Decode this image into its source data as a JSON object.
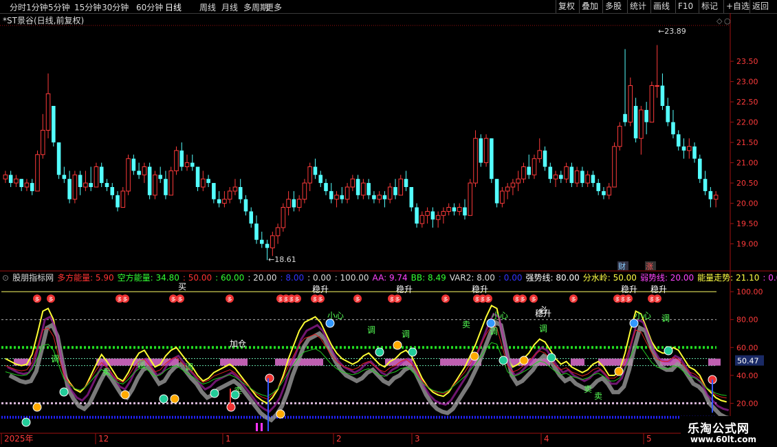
{
  "toolbar": {
    "periods": [
      "分时",
      "1分钟",
      "5分钟",
      "15分钟",
      "30分钟",
      "60分钟",
      "日线",
      "周线",
      "月线",
      "多周期",
      "更多"
    ],
    "active": "日线",
    "right_items": [
      "复权",
      "叠加",
      "多股",
      "统计",
      "画线",
      "F10",
      "标记",
      "+自选",
      "返回"
    ]
  },
  "main_chart": {
    "title": "*ST景谷(日线,前复权)",
    "high_marker": "23.89",
    "low_marker": "18.61",
    "markers": {
      "cai": "财",
      "zhang": "涨"
    },
    "colors": {
      "up": "#ff3b3b",
      "down": "#54ffff"
    }
  },
  "indicator": {
    "name": "股朋指标网",
    "fields": [
      {
        "label": "多方能量:",
        "value": "5.90",
        "color": "#ff3333"
      },
      {
        "label": "空方能量:",
        "value": "34.80",
        "color": "#33ff33"
      },
      {
        "label": ":",
        "value": "50.00",
        "color": "#ff3333"
      },
      {
        "label": ":",
        "value": "60.00",
        "color": "#33ff33"
      },
      {
        "label": ":",
        "value": "20.00",
        "color": "#dddddd"
      },
      {
        "label": ":",
        "value": "8.00",
        "color": "#3333ff"
      },
      {
        "label": ":",
        "value": "0.00",
        "color": "#dddddd"
      },
      {
        "label": ":",
        "value": "100.00",
        "color": "#dddddd"
      },
      {
        "label": "AA:",
        "value": "9.74",
        "color": "#ff44ff"
      },
      {
        "label": "BB:",
        "value": "8.49",
        "color": "#33ff33"
      },
      {
        "label": "VAR2:",
        "value": "8.00",
        "color": "#dddddd"
      },
      {
        "label": ":",
        "value": "0.00",
        "color": "#3333ff"
      },
      {
        "label": "强势线:",
        "value": "80.00",
        "color": "#ffffff"
      },
      {
        "label": "分水岭:",
        "value": "50.00",
        "color": "#ffff44"
      },
      {
        "label": "弱势线:",
        "value": "20.00",
        "color": "#ff44ff"
      },
      {
        "label": "能量走势:",
        "value": "21.10",
        "color": "#ffff44"
      },
      {
        "label": ":",
        "value": "0.00",
        "color": "#ff44ff"
      }
    ],
    "current_value": "50.47",
    "labels": {
      "buy": "买",
      "stable": "稳升",
      "careful": "小心",
      "adjust": "调",
      "sell": "卖",
      "add": "加仓",
      "bi": "必"
    }
  },
  "date_axis": [
    "2025年",
    "12",
    "1",
    "2",
    "3",
    "4",
    "5"
  ],
  "watermark": {
    "line1": "乐淘公式网",
    "line2": "www.60lt.com"
  },
  "chart_data": {
    "type": "candlestick",
    "title": "*ST景谷(日线,前复权)",
    "y_ticks": [
      19.0,
      19.5,
      20.0,
      20.5,
      21.0,
      21.5,
      22.0,
      22.5,
      23.0,
      23.5
    ],
    "ylim": [
      18.4,
      24.4
    ],
    "x_labels": [
      "2025年",
      "12",
      "1",
      "2",
      "3",
      "4",
      "5"
    ],
    "candles": [
      [
        20.6,
        20.8,
        20.5,
        20.7
      ],
      [
        20.7,
        20.8,
        20.4,
        20.5
      ],
      [
        20.5,
        20.7,
        20.4,
        20.6
      ],
      [
        20.6,
        20.6,
        20.3,
        20.4
      ],
      [
        20.4,
        20.6,
        20.3,
        20.5
      ],
      [
        20.5,
        20.6,
        20.2,
        20.3
      ],
      [
        20.3,
        21.3,
        20.3,
        21.2
      ],
      [
        21.2,
        22.2,
        21.1,
        21.8
      ],
      [
        21.8,
        23.2,
        21.6,
        22.7
      ],
      [
        22.4,
        22.4,
        21.4,
        21.5
      ],
      [
        21.5,
        21.5,
        20.6,
        20.7
      ],
      [
        20.7,
        20.9,
        20.5,
        20.6
      ],
      [
        20.6,
        20.8,
        20.0,
        20.1
      ],
      [
        20.1,
        20.8,
        20.0,
        20.7
      ],
      [
        20.7,
        20.8,
        20.2,
        20.4
      ],
      [
        20.4,
        20.8,
        20.3,
        20.5
      ],
      [
        20.5,
        20.9,
        20.3,
        20.4
      ],
      [
        20.4,
        21.0,
        20.4,
        20.9
      ],
      [
        20.9,
        21.0,
        20.4,
        20.5
      ],
      [
        20.5,
        20.6,
        20.3,
        20.4
      ],
      [
        20.4,
        20.5,
        20.1,
        20.2
      ],
      [
        20.2,
        20.3,
        19.8,
        19.9
      ],
      [
        19.9,
        20.4,
        19.9,
        20.3
      ],
      [
        20.3,
        21.2,
        20.2,
        21.1
      ],
      [
        21.1,
        21.2,
        20.7,
        20.8
      ],
      [
        20.8,
        21.0,
        20.6,
        20.7
      ],
      [
        20.7,
        21.0,
        20.5,
        20.9
      ],
      [
        20.9,
        21.0,
        20.1,
        20.2
      ],
      [
        20.2,
        20.8,
        20.1,
        20.7
      ],
      [
        20.7,
        20.9,
        20.5,
        20.6
      ],
      [
        20.6,
        20.8,
        20.1,
        20.2
      ],
      [
        20.2,
        20.9,
        20.2,
        20.8
      ],
      [
        20.8,
        21.4,
        20.7,
        21.3
      ],
      [
        21.3,
        21.5,
        20.8,
        20.9
      ],
      [
        20.9,
        21.2,
        20.8,
        21.0
      ],
      [
        21.0,
        21.2,
        20.8,
        20.9
      ],
      [
        20.9,
        20.9,
        20.3,
        20.4
      ],
      [
        20.4,
        20.8,
        20.3,
        20.6
      ],
      [
        20.6,
        20.7,
        20.4,
        20.5
      ],
      [
        20.5,
        20.5,
        20.0,
        20.1
      ],
      [
        20.1,
        20.3,
        19.9,
        20.0
      ],
      [
        20.0,
        20.3,
        19.9,
        20.1
      ],
      [
        20.1,
        20.4,
        20.0,
        20.3
      ],
      [
        20.3,
        20.6,
        20.2,
        20.4
      ],
      [
        20.4,
        20.6,
        20.0,
        20.1
      ],
      [
        20.1,
        20.2,
        19.7,
        19.8
      ],
      [
        19.8,
        19.9,
        19.4,
        19.5
      ],
      [
        19.5,
        19.7,
        19.0,
        19.1
      ],
      [
        19.1,
        19.3,
        18.9,
        19.0
      ],
      [
        19.0,
        19.1,
        18.6,
        18.9
      ],
      [
        18.9,
        19.3,
        18.7,
        19.2
      ],
      [
        19.2,
        19.5,
        19.0,
        19.4
      ],
      [
        19.4,
        20.0,
        19.3,
        19.9
      ],
      [
        19.9,
        20.3,
        19.7,
        20.1
      ],
      [
        20.1,
        20.3,
        19.8,
        19.9
      ],
      [
        19.9,
        20.2,
        19.8,
        20.1
      ],
      [
        20.1,
        20.6,
        20.0,
        20.5
      ],
      [
        20.5,
        21.0,
        20.3,
        20.9
      ],
      [
        20.9,
        21.1,
        20.6,
        20.7
      ],
      [
        20.7,
        20.8,
        20.4,
        20.5
      ],
      [
        20.5,
        20.6,
        20.2,
        20.3
      ],
      [
        20.3,
        20.5,
        20.0,
        20.1
      ],
      [
        20.1,
        20.3,
        19.9,
        20.2
      ],
      [
        20.2,
        20.4,
        20.0,
        20.1
      ],
      [
        20.1,
        20.5,
        20.0,
        20.4
      ],
      [
        20.4,
        20.7,
        20.3,
        20.6
      ],
      [
        20.6,
        20.7,
        20.1,
        20.2
      ],
      [
        20.2,
        20.6,
        20.1,
        20.5
      ],
      [
        20.5,
        20.6,
        20.1,
        20.2
      ],
      [
        20.2,
        20.3,
        20.0,
        20.1
      ],
      [
        20.1,
        20.3,
        20.0,
        20.2
      ],
      [
        20.2,
        20.3,
        19.9,
        20.1
      ],
      [
        20.1,
        20.5,
        20.0,
        20.4
      ],
      [
        20.4,
        20.6,
        20.1,
        20.2
      ],
      [
        20.2,
        20.7,
        20.2,
        20.6
      ],
      [
        20.6,
        20.8,
        20.3,
        20.4
      ],
      [
        20.4,
        20.4,
        19.8,
        19.9
      ],
      [
        19.9,
        20.0,
        19.4,
        19.5
      ],
      [
        19.5,
        19.8,
        19.4,
        19.7
      ],
      [
        19.7,
        19.9,
        19.5,
        19.8
      ],
      [
        19.8,
        19.9,
        19.4,
        19.6
      ],
      [
        19.6,
        19.8,
        19.4,
        19.7
      ],
      [
        19.7,
        19.9,
        19.5,
        19.8
      ],
      [
        19.8,
        20.0,
        19.7,
        19.9
      ],
      [
        19.9,
        20.0,
        19.7,
        19.8
      ],
      [
        19.8,
        20.0,
        19.7,
        19.9
      ],
      [
        19.9,
        20.1,
        19.6,
        19.7
      ],
      [
        19.7,
        20.6,
        19.7,
        20.5
      ],
      [
        20.5,
        21.8,
        20.4,
        21.6
      ],
      [
        21.6,
        21.7,
        20.9,
        21.0
      ],
      [
        21.0,
        21.7,
        20.9,
        21.6
      ],
      [
        21.6,
        21.6,
        20.5,
        20.6
      ],
      [
        20.6,
        20.6,
        19.9,
        20.0
      ],
      [
        20.0,
        20.4,
        19.9,
        20.3
      ],
      [
        20.3,
        20.5,
        20.1,
        20.4
      ],
      [
        20.4,
        20.6,
        20.2,
        20.5
      ],
      [
        20.5,
        20.8,
        20.3,
        20.6
      ],
      [
        20.6,
        21.0,
        20.5,
        20.9
      ],
      [
        20.9,
        21.2,
        20.6,
        20.7
      ],
      [
        20.7,
        21.2,
        20.6,
        21.1
      ],
      [
        21.1,
        21.6,
        21.0,
        21.3
      ],
      [
        21.3,
        21.4,
        20.8,
        20.9
      ],
      [
        20.9,
        21.0,
        20.5,
        20.6
      ],
      [
        20.6,
        20.8,
        20.4,
        20.7
      ],
      [
        20.7,
        20.8,
        20.5,
        20.6
      ],
      [
        20.6,
        21.0,
        20.5,
        20.9
      ],
      [
        20.9,
        21.0,
        20.4,
        20.5
      ],
      [
        20.5,
        20.9,
        20.4,
        20.8
      ],
      [
        20.8,
        20.9,
        20.4,
        20.5
      ],
      [
        20.5,
        20.8,
        20.4,
        20.7
      ],
      [
        20.7,
        20.8,
        20.4,
        20.5
      ],
      [
        20.5,
        20.6,
        20.2,
        20.3
      ],
      [
        20.3,
        20.4,
        20.1,
        20.2
      ],
      [
        20.2,
        20.5,
        20.1,
        20.4
      ],
      [
        20.4,
        21.5,
        20.4,
        21.4
      ],
      [
        21.4,
        22.0,
        21.3,
        21.9
      ],
      [
        22.2,
        23.8,
        21.9,
        22.0
      ],
      [
        22.0,
        23.1,
        21.9,
        22.9
      ],
      [
        22.4,
        22.6,
        21.5,
        21.6
      ],
      [
        21.6,
        22.4,
        21.2,
        22.3
      ],
      [
        22.3,
        22.5,
        21.7,
        22.0
      ],
      [
        22.0,
        23.0,
        22.0,
        22.9
      ],
      [
        22.9,
        23.9,
        22.6,
        22.9
      ],
      [
        22.9,
        23.2,
        22.3,
        22.4
      ],
      [
        22.4,
        22.6,
        21.9,
        22.0
      ],
      [
        22.0,
        22.3,
        21.6,
        21.7
      ],
      [
        21.7,
        21.8,
        21.3,
        21.4
      ],
      [
        21.4,
        21.6,
        21.1,
        21.3
      ],
      [
        21.3,
        21.6,
        21.1,
        21.4
      ],
      [
        21.4,
        21.5,
        21.0,
        21.1
      ],
      [
        21.1,
        21.2,
        20.5,
        20.6
      ],
      [
        20.6,
        20.8,
        20.2,
        20.3
      ],
      [
        20.3,
        20.4,
        19.9,
        20.1
      ],
      [
        20.1,
        20.3,
        19.9,
        20.2
      ]
    ],
    "indicator_yticks": [
      20.0,
      40.0,
      60.0,
      80.0,
      100.0
    ],
    "indicator_ylim": [
      0,
      105
    ],
    "indicator_series": {
      "yellow_energy": [
        52,
        50,
        48,
        47,
        48,
        55,
        70,
        86,
        88,
        80,
        60,
        42,
        35,
        30,
        28,
        32,
        40,
        48,
        55,
        50,
        44,
        38,
        36,
        42,
        50,
        56,
        58,
        52,
        46,
        48,
        54,
        58,
        60,
        55,
        50,
        46,
        40,
        36,
        38,
        42,
        44,
        46,
        48,
        45,
        40,
        35,
        30,
        25,
        22,
        20,
        24,
        30,
        40,
        52,
        62,
        72,
        78,
        80,
        82,
        78,
        70,
        62,
        56,
        52,
        50,
        48,
        50,
        54,
        56,
        52,
        48,
        46,
        50,
        52,
        56,
        58,
        54,
        46,
        38,
        32,
        28,
        26,
        25,
        28,
        34,
        40,
        46,
        54,
        62,
        72,
        82,
        90,
        88,
        70,
        52,
        46,
        48,
        52,
        56,
        62,
        66,
        64,
        58,
        52,
        48,
        50,
        46,
        44,
        42,
        44,
        48,
        50,
        46,
        40,
        40,
        44,
        56,
        72,
        86,
        84,
        74,
        64,
        58,
        56,
        56,
        60,
        58,
        52,
        46,
        44,
        40,
        32,
        28,
        24,
        22,
        21
      ]
    }
  }
}
